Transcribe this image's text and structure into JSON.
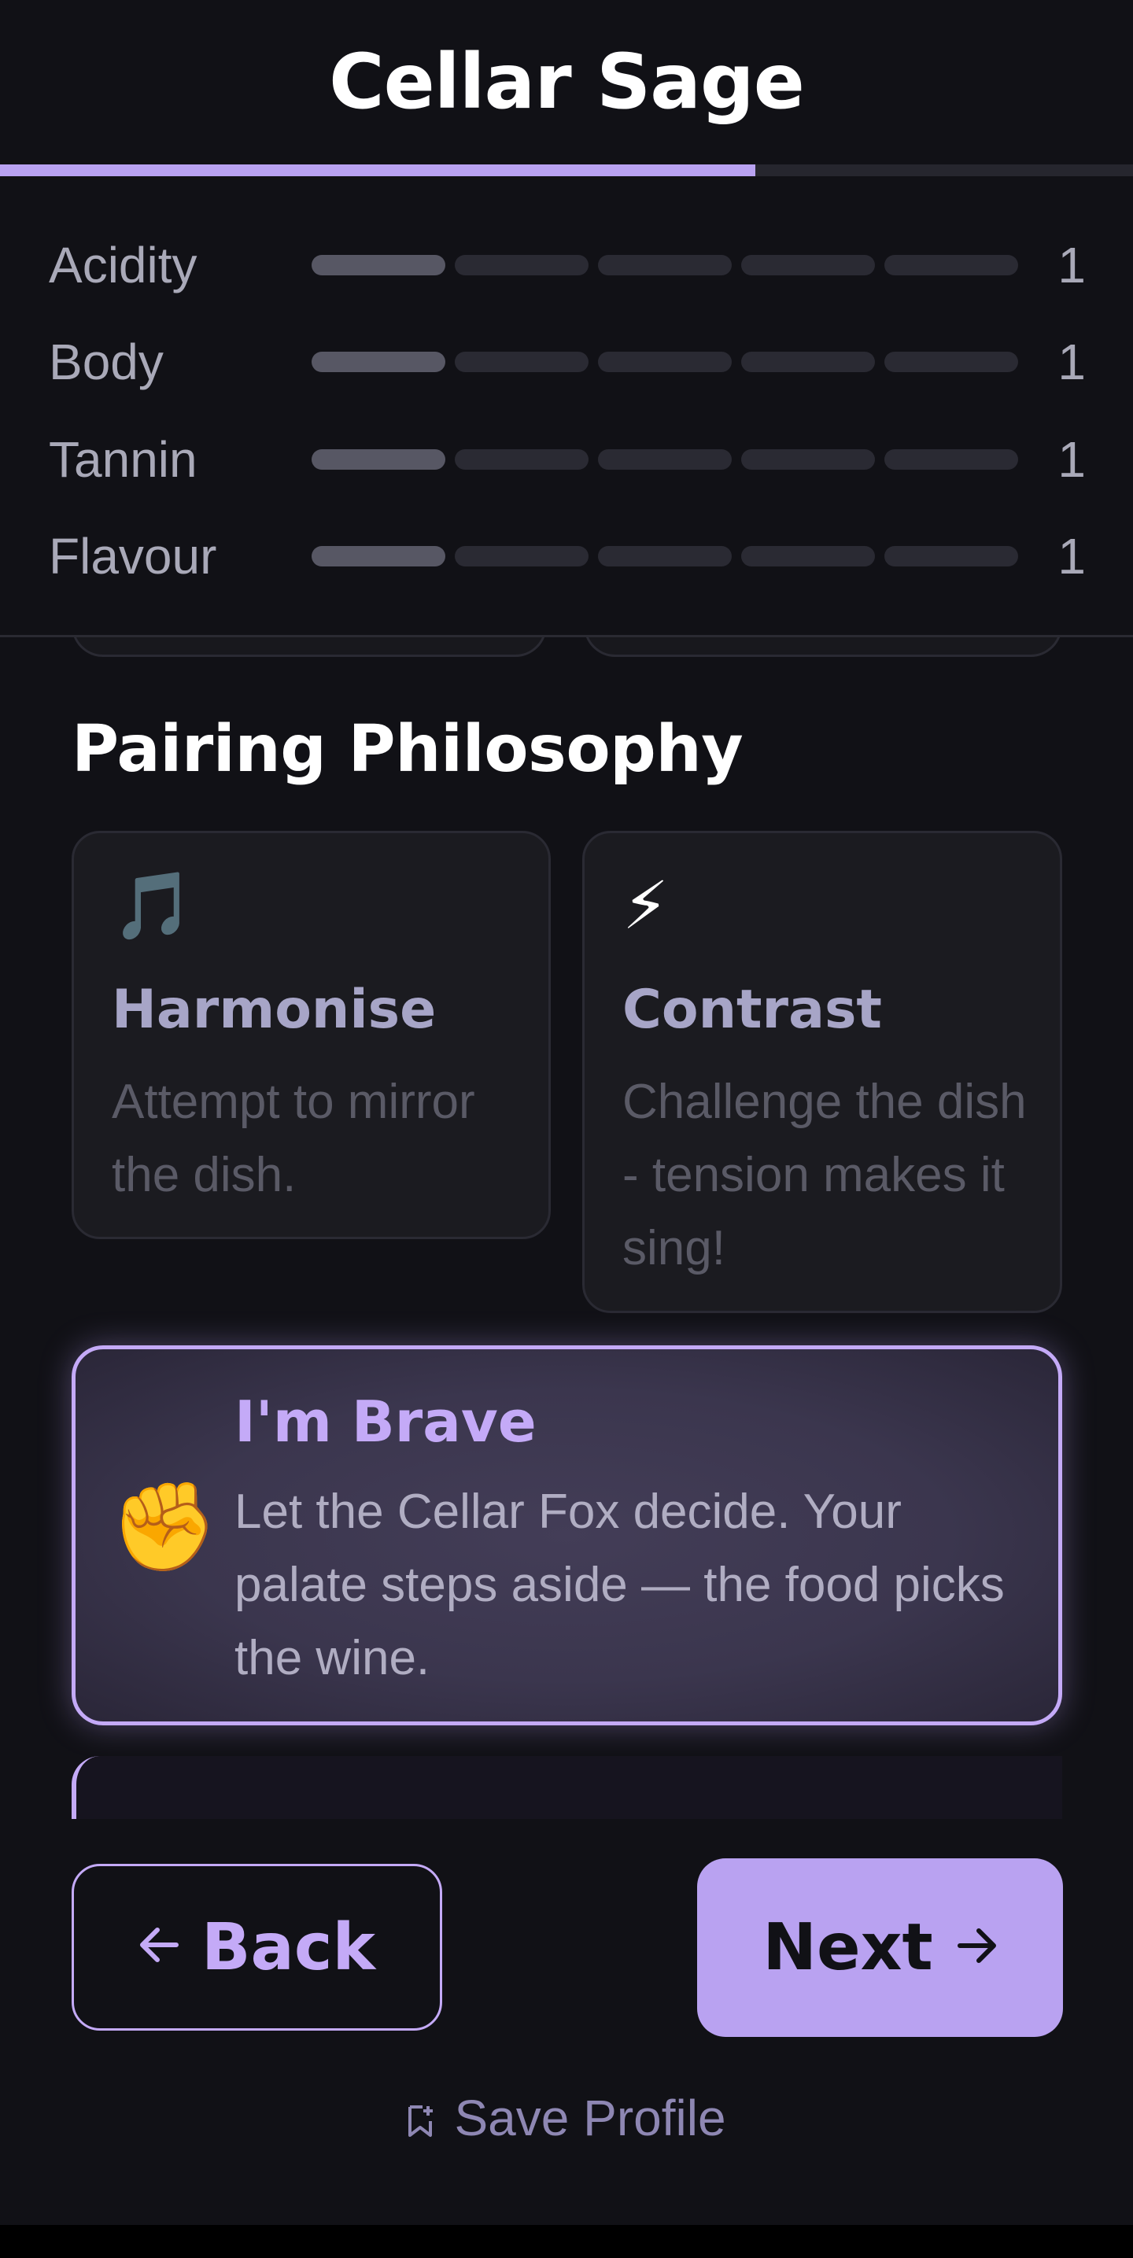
{
  "app": {
    "title": "Cellar Sage",
    "progress_fraction": 0.667
  },
  "profile": {
    "attributes": [
      {
        "label": "Acidity",
        "level": 1,
        "max": 5,
        "value": "1"
      },
      {
        "label": "Body",
        "level": 1,
        "max": 5,
        "value": "1"
      },
      {
        "label": "Tannin",
        "level": 1,
        "max": 5,
        "value": "1"
      },
      {
        "label": "Flavour",
        "level": 1,
        "max": 5,
        "value": "1"
      }
    ]
  },
  "philosophy": {
    "title": "Pairing Philosophy",
    "options": [
      {
        "emoji": "🎵",
        "icon": "music-note-icon",
        "title": "Harmonise",
        "description": "Attempt to mirror the dish.",
        "selected": false
      },
      {
        "emoji": "⚡",
        "icon": "lightning-icon",
        "title": "Contrast",
        "description": "Challenge the dish - tension makes it sing!",
        "selected": false
      },
      {
        "emoji": "✊",
        "icon": "raised-fist-icon",
        "title": "I'm Brave",
        "description": "Let the Cellar Fox decide. Your palate steps aside — the food picks the wine.",
        "selected": true
      }
    ]
  },
  "footer": {
    "back_label": "Back",
    "back_icon": "arrow-left-icon",
    "next_label": "Next",
    "next_icon": "arrow-right-icon",
    "save_label": "Save Profile",
    "save_icon": "bookmark-plus-icon"
  },
  "colors": {
    "accent": "#b9a2f1",
    "background": "#111116",
    "card": "#1b1b20"
  }
}
